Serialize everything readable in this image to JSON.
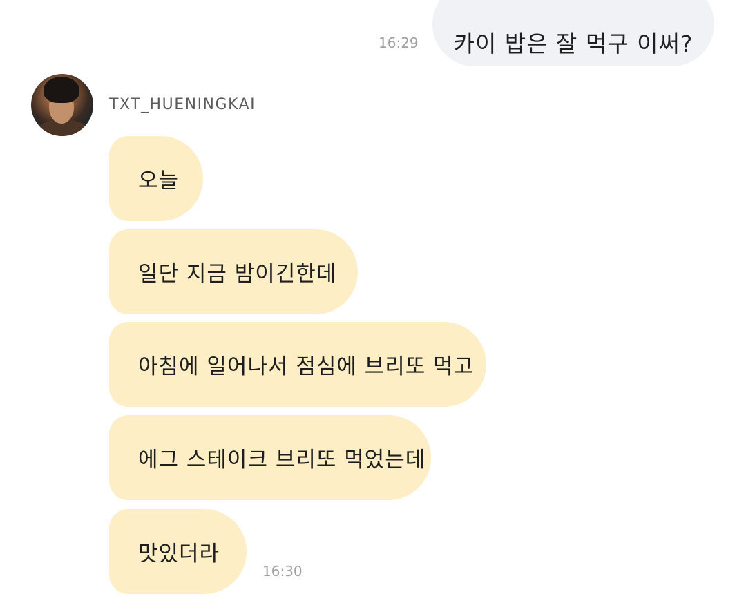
{
  "outgoing": {
    "message": "카이 밥은 잘 먹구 이써?",
    "time": "16:29"
  },
  "sender": {
    "name": "TXT_HUENINGKAI",
    "avatar_icon": "profile-photo"
  },
  "incoming": {
    "messages": [
      "오늘",
      "일단 지금 밤이긴한데",
      "아침에 일어나서 점심에 브리또 먹고",
      "에그 스테이크 브리또 먹었는데",
      "맛있더라"
    ],
    "time": "16:30"
  },
  "colors": {
    "outgoing_bubble": "#f1f2f6",
    "incoming_bubble": "#feeec5",
    "timestamp": "#a0a0a0",
    "sender_name": "#5c5c5c"
  }
}
